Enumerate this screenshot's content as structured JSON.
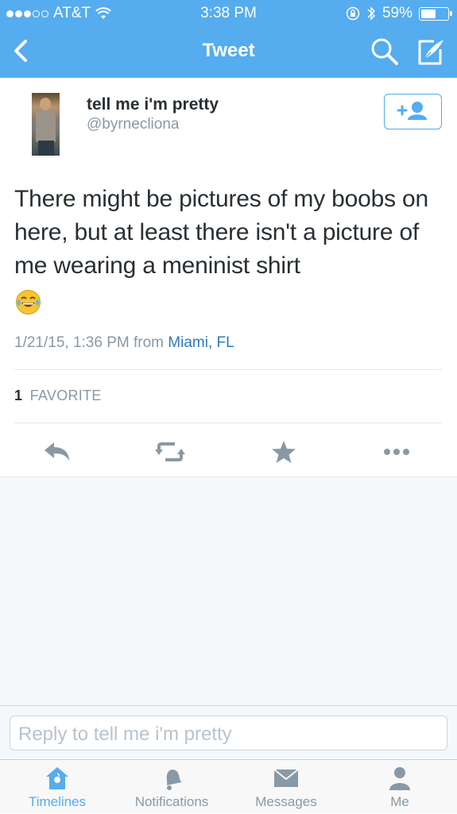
{
  "status_bar": {
    "carrier": "AT&T",
    "time": "3:38 PM",
    "battery": "59%",
    "battery_level": 0.59,
    "signal_bars_filled": 3,
    "signal_bars_total": 5
  },
  "nav": {
    "title": "Tweet",
    "back_icon": "back-chevron-icon",
    "search_icon": "search-icon",
    "compose_icon": "compose-icon"
  },
  "tweet": {
    "display_name": "tell me i'm pretty",
    "handle": "@byrnecliona",
    "text": "There might be pictures of my boobs on here, but at least there isn't a picture of me wearing a meninist shirt",
    "emoji": "face-with-tears-of-joy",
    "timestamp": "1/21/15, 1:36 PM from",
    "location": "Miami, FL",
    "favorite_count": "1",
    "favorite_label": "FAVORITE"
  },
  "reply": {
    "placeholder": "Reply to tell me i'm pretty"
  },
  "tabs": [
    {
      "label": "Timelines",
      "icon": "home-icon",
      "active": true
    },
    {
      "label": "Notifications",
      "icon": "bell-icon",
      "active": false
    },
    {
      "label": "Messages",
      "icon": "envelope-icon",
      "active": false
    },
    {
      "label": "Me",
      "icon": "person-icon",
      "active": false
    }
  ],
  "colors": {
    "brand": "#55acee",
    "text": "#292f33",
    "muted": "#8899a6",
    "link": "#2b7bb9",
    "icon": "#8899a6"
  }
}
